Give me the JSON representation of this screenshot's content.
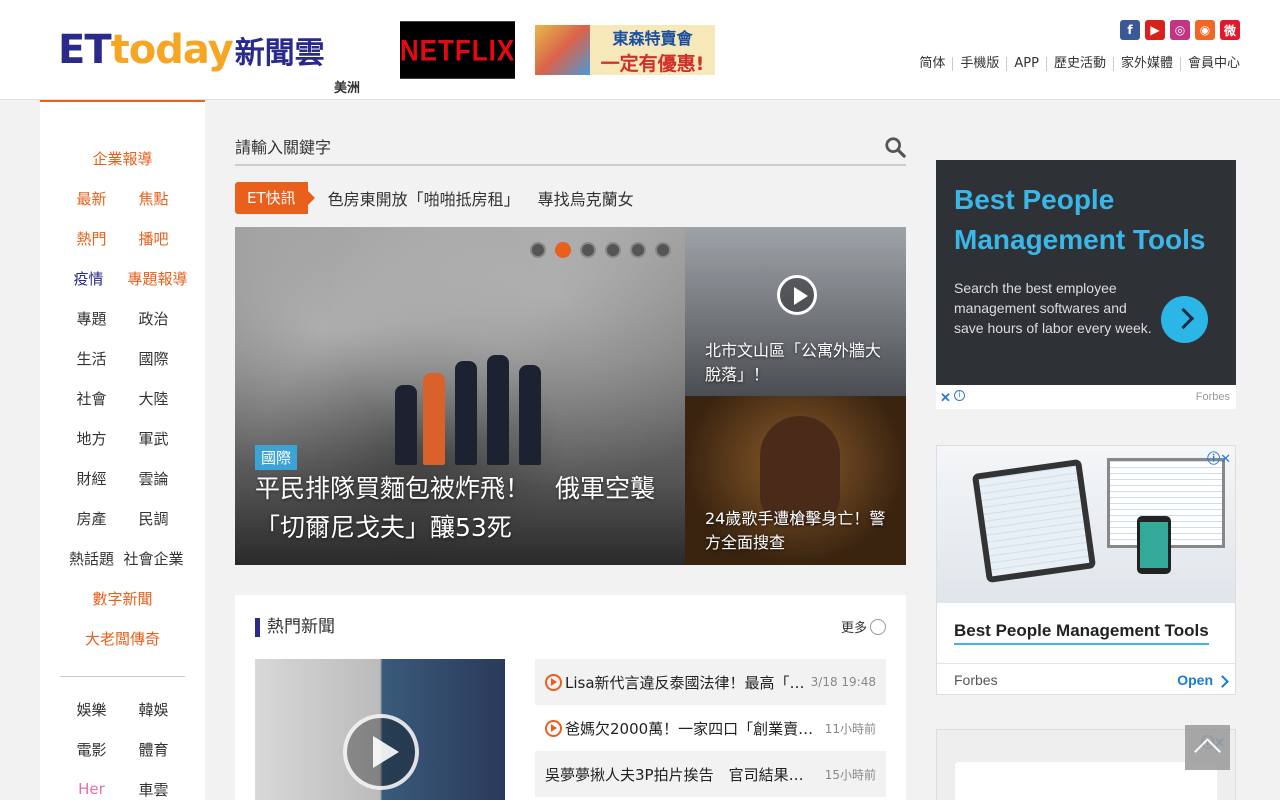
{
  "header": {
    "logo_en": "ETtoday",
    "logo_cn": "新聞雲",
    "region": "美洲",
    "ad_netflix": "NETFLIX",
    "ad_tosen_line1": "東森特賣會",
    "ad_tosen_line2": "一定有優惠!",
    "social": [
      "facebook-icon",
      "youtube-icon",
      "instagram-icon",
      "rss-icon",
      "weibo-icon"
    ],
    "nav": [
      "简体",
      "手機版",
      "APP",
      "歷史活動",
      "家外媒體",
      "會員中心"
    ]
  },
  "sidebar": {
    "enterprise": "企業報導",
    "rows": [
      [
        "最新",
        "焦點"
      ],
      [
        "熱門",
        "播吧"
      ],
      [
        "疫情",
        "專題報導"
      ],
      [
        "專題",
        "政治"
      ],
      [
        "生活",
        "國際"
      ],
      [
        "社會",
        "大陸"
      ],
      [
        "地方",
        "軍武"
      ],
      [
        "財經",
        "雲論"
      ],
      [
        "房產",
        "民調"
      ],
      [
        "熱話題",
        "社會企業"
      ]
    ],
    "digital": "數字新聞",
    "boss": "大老闆傳奇",
    "rows2": [
      [
        "娛樂",
        "韓娛"
      ],
      [
        "電影",
        "體育"
      ],
      [
        "Her",
        "車雲"
      ]
    ]
  },
  "search": {
    "placeholder": "請輸入關鍵字"
  },
  "flash": {
    "tag": "ET快訊",
    "items": [
      "色房東開放「啪啪抵房租」",
      "專找烏克蘭女"
    ]
  },
  "hero": {
    "category": "國際",
    "title": "平民排隊買麵包被炸飛！　俄軍空襲「切爾尼戈夫」釀53死",
    "slide_count": 6,
    "active_slide": 2
  },
  "side_stories": [
    {
      "title": "北市文山區「公寓外牆大脫落」！"
    },
    {
      "title": "24歲歌手遭槍擊身亡！警方全面搜查"
    }
  ],
  "hot_news": {
    "heading": "熱門新聞",
    "more": "更多",
    "items": [
      {
        "title": "Lisa新代言違反泰國法律！最高「…",
        "time": "3/18 19:48"
      },
      {
        "title": "爸媽欠2000萬！一家四口「創業賣…",
        "time": "11小時前"
      },
      {
        "title": "吳夢夢揪人夫3P拍片挨告　官司結果…",
        "time": "15小時前"
      }
    ]
  },
  "ads": {
    "ad1_title": "Best People Management Tools",
    "ad1_desc": "Search the best employee management softwares and save hours of labor every week.",
    "ad1_brand": "Forbes",
    "ad2_title": "Best People Management Tools",
    "ad2_brand": "Forbes",
    "ad2_open": "Open"
  },
  "colors": {
    "accent": "#e8601c",
    "navy": "#2a2a8a",
    "ad_blue": "#3bb6e8"
  }
}
